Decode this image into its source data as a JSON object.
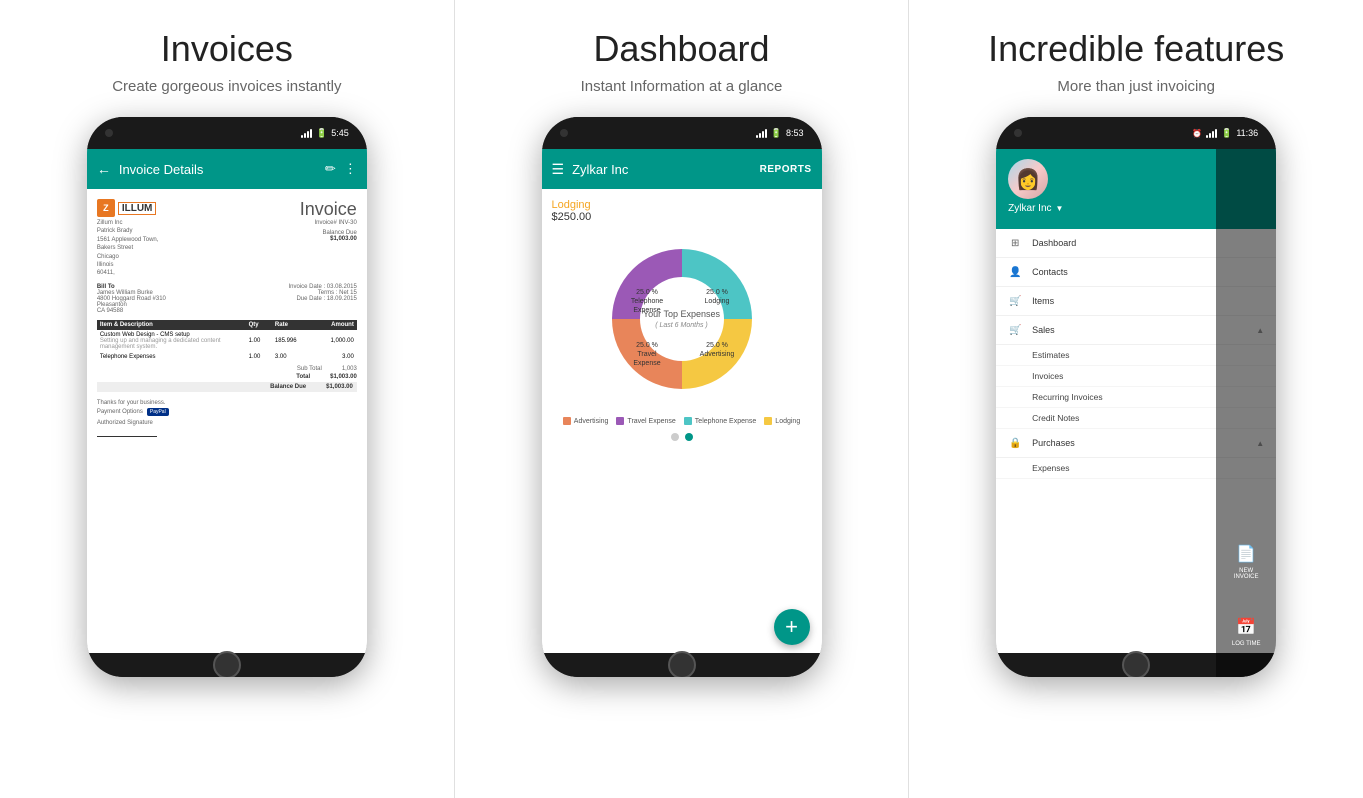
{
  "panels": [
    {
      "id": "invoices",
      "title": "Invoices",
      "subtitle": "Create gorgeous invoices instantly",
      "phone": {
        "status_time": "5:45",
        "toolbar_title": "Invoice Details",
        "invoice": {
          "company_logo_letter": "Z",
          "company_logo_text": "ILLUM",
          "company_name": "Zillum Inc",
          "company_address1": "Patrick Brady",
          "company_address2": "1561 Applewood Town,",
          "company_address3": "Bakers Street",
          "company_address4": "Chicago",
          "company_address5": "Illinois",
          "company_address6": "60411,",
          "invoice_word": "Invoice",
          "invoice_number": "Invoice# INV-30",
          "balance_due_label": "Balance Due",
          "balance_due_amount": "$1,003.00",
          "bill_to_label": "Bill To",
          "bill_to_name": "James William Burke",
          "bill_to_address1": "4800 Hoggard Road #310",
          "bill_to_city": "Pleasanton",
          "bill_to_state": "CA 94588",
          "invoice_date_label": "Invoice Date :",
          "invoice_date_value": "03.08.2015",
          "terms_label": "Terms :",
          "terms_value": "Net 15",
          "due_date_label": "Due Date :",
          "due_date_value": "18.09.2015",
          "table_headers": [
            "Item & Description",
            "Qty",
            "Rate",
            "Amount"
          ],
          "table_rows": [
            [
              "Custom Web Design - CMS setup\nSetting up and managing a dedicated content management system.",
              "1.00",
              "185.996",
              "1,000.00"
            ],
            [
              "Telephone Expenses",
              "1.00",
              "3.00",
              "3.00"
            ]
          ],
          "sub_total_label": "Sub Total",
          "sub_total_value": "1,003",
          "total_label": "Total",
          "total_value": "$1,003.00",
          "balance_due_footer_label": "Balance Due",
          "balance_due_footer_value": "$1,003.00",
          "thanks_text": "Thanks for your business.",
          "payment_label": "Payment Options",
          "paypal_text": "PayPal",
          "authorized_sig_label": "Authorized Signature"
        }
      }
    },
    {
      "id": "dashboard",
      "title": "Dashboard",
      "subtitle": "Instant Information at a glance",
      "phone": {
        "status_time": "8:53",
        "toolbar_title": "Zylkar Inc",
        "reports_btn": "REPORTS",
        "chart": {
          "center_label": "Your Top Expenses",
          "center_sublabel": "( Last 6 Months )",
          "lodging_label": "Lodging",
          "lodging_amount": "$250.00",
          "slices": [
            {
              "label": "25.0 %\nTelephone Expense",
              "color": "#4dc5c5",
              "percent": 25
            },
            {
              "label": "25.0 %\nLodging",
              "color": "#f5c842",
              "percent": 25
            },
            {
              "label": "25.0 %\nAdvertising",
              "color": "#e8855a",
              "percent": 25
            },
            {
              "label": "25.0 %\nTravel Expense",
              "color": "#9b59b6",
              "percent": 25
            }
          ]
        },
        "legend": [
          {
            "color": "#e8855a",
            "label": "Advertising"
          },
          {
            "color": "#9b59b6",
            "label": "Travel Expense"
          },
          {
            "color": "#4dc5c5",
            "label": "Telephone Expense"
          },
          {
            "color": "#f5c842",
            "label": "Lodging"
          }
        ],
        "fab_label": "+"
      }
    },
    {
      "id": "features",
      "title": "Incredible features",
      "subtitle": "More than just invoicing",
      "phone": {
        "status_time": "11:36",
        "company_name": "Zylkar Inc",
        "nav_items": [
          {
            "icon": "⊞",
            "label": "Dashboard"
          },
          {
            "icon": "👤",
            "label": "Contacts"
          },
          {
            "icon": "🛒",
            "label": "Items"
          },
          {
            "icon": "🛒",
            "label": "Sales",
            "has_arrow": true,
            "expanded": true
          }
        ],
        "sales_sub_items": [
          "Estimates",
          "Invoices",
          "Recurring Invoices",
          "Credit Notes"
        ],
        "purchases_item": {
          "icon": "🔒",
          "label": "Purchases",
          "has_arrow": true,
          "expanded": true
        },
        "purchases_sub_items": [
          "Expenses"
        ],
        "side_buttons": [
          {
            "icon": "📄",
            "label": "NEW INVOICE"
          },
          {
            "icon": "📅",
            "label": "LOG TIME"
          }
        ]
      }
    }
  ]
}
